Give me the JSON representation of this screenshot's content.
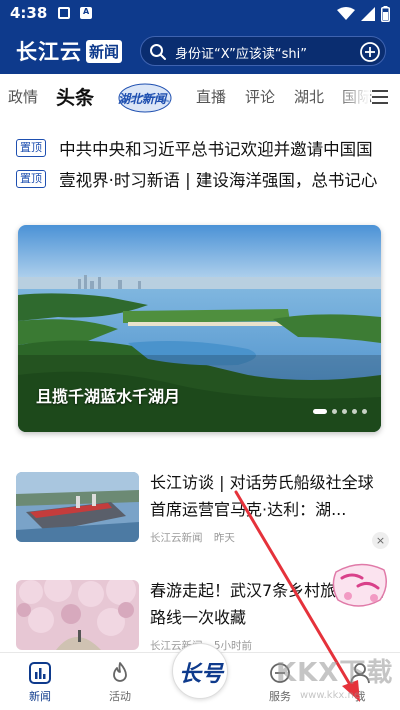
{
  "status_bar": {
    "time": "4:38"
  },
  "header": {
    "logo_main": "长江云",
    "logo_box": "新闻",
    "search_text": "身份证“X”应该读“shi”"
  },
  "tabs": {
    "items": [
      "政情",
      "头条",
      "直播",
      "评论",
      "湖北",
      "国际"
    ],
    "active": "头条",
    "badge_label": "湖北新闻"
  },
  "pinned": [
    {
      "badge": "置顶",
      "title": "中共中央和习近平总书记欢迎并邀请中国国"
    },
    {
      "badge": "置顶",
      "title": "壹视界·时习新语 | 建设海洋强国，总书记心"
    }
  ],
  "hero": {
    "caption": "且揽千湖蓝水千湖月",
    "slide_count": 5,
    "active_slide": 1
  },
  "news": [
    {
      "title": "长江访谈 | 对话劳氏船级社全球首席运营官马克·达利：湖...",
      "source": "长江云新闻",
      "time": "昨天"
    },
    {
      "title": "春游走起！武汉7条乡村旅游精品路线一次收藏",
      "source": "长江云新闻",
      "time": "5小时前"
    }
  ],
  "close_label": "×",
  "bottom_nav": {
    "news": "新闻",
    "activity": "活动",
    "center": "长号",
    "service": "服务",
    "me": "我"
  },
  "watermark": {
    "text": "KKX下载",
    "url": "www.kkx.net"
  },
  "colors": {
    "brand": "#0e3a8c",
    "accent_arrow": "#e5323b"
  }
}
